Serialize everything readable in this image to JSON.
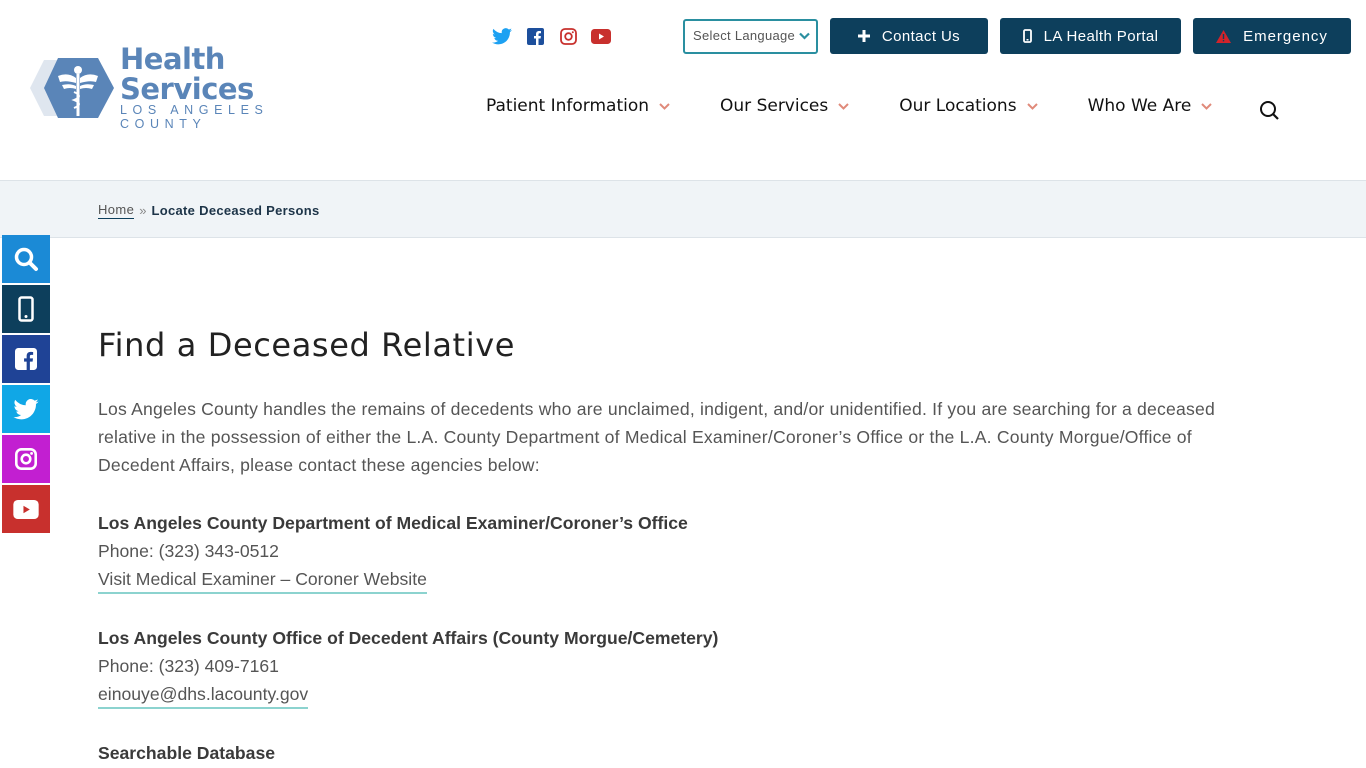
{
  "brand": {
    "title": "Health Services",
    "subtitle": "LOS ANGELES COUNTY",
    "color": "#5a85b8"
  },
  "header": {
    "social": [
      {
        "name": "twitter-icon",
        "color": "#1da1f2"
      },
      {
        "name": "facebook-icon",
        "color": "#1d4f9c"
      },
      {
        "name": "instagram-icon",
        "color": "#c8302d"
      },
      {
        "name": "youtube-icon",
        "color": "#c8302d"
      }
    ],
    "language_select": "Select Language",
    "buttons": {
      "contact": "Contact Us",
      "portal": "LA Health Portal",
      "emergency": "Emergency"
    },
    "nav": [
      {
        "label": "Patient Information"
      },
      {
        "label": "Our Services"
      },
      {
        "label": "Our Locations"
      },
      {
        "label": "Who We Are"
      }
    ],
    "accent": "#0d3f5c",
    "chevron_color": "#e08a7a"
  },
  "breadcrumb": {
    "home": "Home",
    "separator": "»",
    "current": "Locate Deceased Persons"
  },
  "side_bar": [
    {
      "name": "search",
      "color": "#1b8ad6"
    },
    {
      "name": "mobile",
      "color": "#0d3f5c"
    },
    {
      "name": "facebook",
      "color": "#1f4396"
    },
    {
      "name": "twitter",
      "color": "#10a7e6"
    },
    {
      "name": "instagram",
      "color": "#c21fd1"
    },
    {
      "name": "youtube",
      "color": "#c8302d"
    }
  ],
  "main": {
    "title": "Find a Deceased Relative",
    "intro": "Los Angeles County handles the remains of decedents who are unclaimed, indigent, and/or unidentified. If you are searching for a deceased relative in the possession of either the L.A. County Department of Medical Examiner/Coroner’s Office or the L.A. County Morgue/Office of Decedent Affairs, please contact these agencies below:",
    "agencies": [
      {
        "name": "Los Angeles County Department of Medical Examiner/Coroner’s Office",
        "phone": "Phone: (323) 343-0512",
        "link": "Visit Medical Examiner – Coroner Website"
      },
      {
        "name": "Los Angeles County Office of Decedent Affairs (County Morgue/Cemetery)",
        "phone": "Phone: (323) 409-7161",
        "link": "einouye@dhs.lacounty.gov"
      }
    ],
    "database_heading": "Searchable Database"
  }
}
